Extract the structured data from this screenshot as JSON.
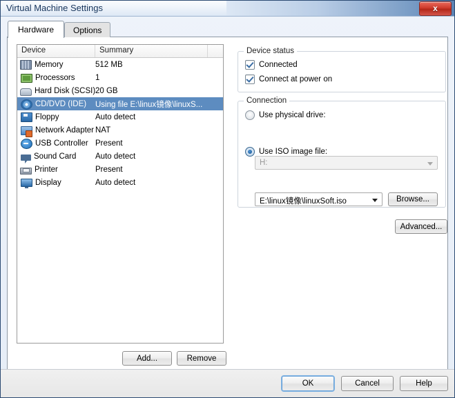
{
  "window": {
    "title": "Virtual Machine Settings",
    "close_label": "x"
  },
  "tabs": [
    {
      "label": "Hardware",
      "active": true
    },
    {
      "label": "Options",
      "active": false
    }
  ],
  "device_list": {
    "columns": [
      "Device",
      "Summary",
      ""
    ],
    "rows": [
      {
        "device": "Memory",
        "summary": "512 MB",
        "icon": "memory-icon",
        "selected": false
      },
      {
        "device": "Processors",
        "summary": "1",
        "icon": "cpu-icon",
        "selected": false
      },
      {
        "device": "Hard Disk (SCSI)",
        "summary": "20 GB",
        "icon": "hard-disk-icon",
        "selected": false
      },
      {
        "device": "CD/DVD (IDE)",
        "summary": "Using file E:\\linux镜像\\linuxS...",
        "icon": "cd-dvd-icon",
        "selected": true
      },
      {
        "device": "Floppy",
        "summary": "Auto detect",
        "icon": "floppy-icon",
        "selected": false
      },
      {
        "device": "Network Adapter",
        "summary": "NAT",
        "icon": "network-adapter-icon",
        "selected": false
      },
      {
        "device": "USB Controller",
        "summary": "Present",
        "icon": "usb-icon",
        "selected": false
      },
      {
        "device": "Sound Card",
        "summary": "Auto detect",
        "icon": "sound-card-icon",
        "selected": false
      },
      {
        "device": "Printer",
        "summary": "Present",
        "icon": "printer-icon",
        "selected": false
      },
      {
        "device": "Display",
        "summary": "Auto detect",
        "icon": "display-icon",
        "selected": false
      }
    ],
    "add_label": "Add...",
    "remove_label": "Remove"
  },
  "device_status": {
    "legend": "Device status",
    "connected": {
      "label": "Connected",
      "checked": true
    },
    "connect_at_power_on": {
      "label": "Connect at power on",
      "checked": true
    }
  },
  "connection": {
    "legend": "Connection",
    "use_physical_drive": {
      "label": "Use physical drive:",
      "selected": false
    },
    "physical_drive_value": "H:",
    "use_iso_image": {
      "label": "Use ISO image file:",
      "selected": true
    },
    "iso_path": "E:\\linux镜像\\linuxSoft.iso",
    "browse_label": "Browse...",
    "advanced_label": "Advanced..."
  },
  "footer": {
    "ok_label": "OK",
    "cancel_label": "Cancel",
    "help_label": "Help"
  },
  "colors": {
    "selection_blue": "#5d8cc0",
    "title_text": "#17355c",
    "close_red": "#cf3b2c",
    "radio_blue": "#14538f",
    "check_blue": "#3b6ea5"
  }
}
